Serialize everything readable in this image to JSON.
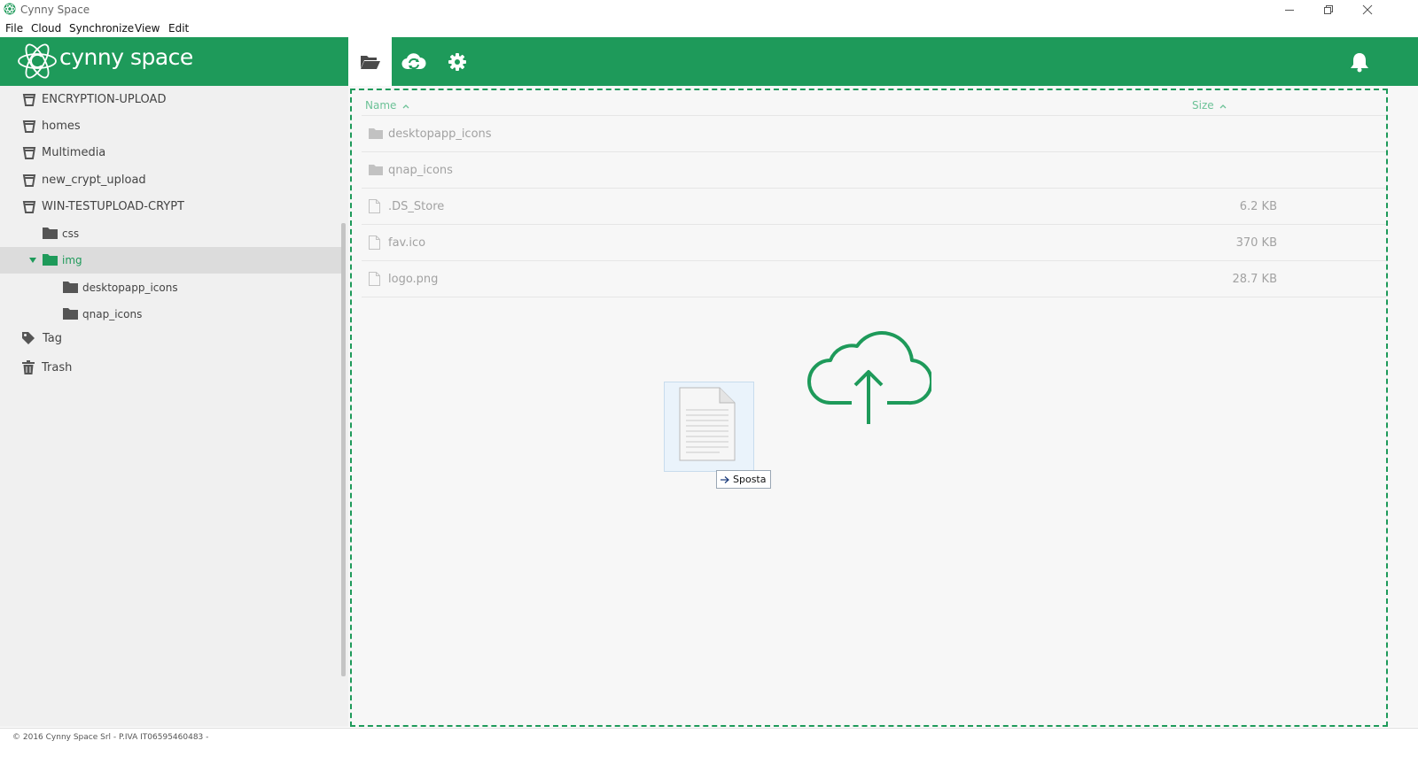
{
  "window": {
    "title": "Cynny Space",
    "controls": [
      "minimize-icon",
      "restore-icon",
      "close-icon"
    ]
  },
  "menu": {
    "items": [
      "File",
      "Cloud",
      "Synchronize",
      "View",
      "Edit"
    ]
  },
  "brand": {
    "logo_text": "cynny space",
    "accent": "#1e9a5a"
  },
  "toolbar": {
    "tabs": [
      {
        "icon": "folder-open-icon",
        "active": true
      },
      {
        "icon": "cloud-sync-icon",
        "active": false
      },
      {
        "icon": "gear-icon",
        "active": false
      }
    ],
    "notifications_icon": "bell-icon"
  },
  "sidebar": {
    "items": [
      {
        "label": "ENCRYPTION-UPLOAD",
        "icon": "storage-bucket-icon"
      },
      {
        "label": "homes",
        "icon": "storage-bucket-icon"
      },
      {
        "label": "Multimedia",
        "icon": "storage-bucket-icon"
      },
      {
        "label": "new_crypt_upload",
        "icon": "storage-bucket-icon"
      },
      {
        "label": "WIN-TESTUPLOAD-CRYPT",
        "icon": "storage-bucket-icon"
      },
      {
        "label": "css",
        "icon": "folder-icon"
      },
      {
        "label": "img",
        "icon": "folder-icon",
        "selected": true,
        "expanded": true
      },
      {
        "label": "desktopapp_icons",
        "icon": "folder-icon"
      },
      {
        "label": "qnap_icons",
        "icon": "folder-icon"
      },
      {
        "label": "Tag",
        "icon": "tag-icon"
      },
      {
        "label": "Trash",
        "icon": "trash-icon"
      }
    ]
  },
  "files": {
    "columns": {
      "name": "Name",
      "size": "Size"
    },
    "rows": [
      {
        "name": "desktopapp_icons",
        "size": "",
        "type": "folder"
      },
      {
        "name": "qnap_icons",
        "size": "",
        "type": "folder"
      },
      {
        "name": ".DS_Store",
        "size": "6.2 KB",
        "type": "file"
      },
      {
        "name": "fav.ico",
        "size": "370 KB",
        "type": "file"
      },
      {
        "name": "logo.png",
        "size": "28.7 KB",
        "type": "file"
      }
    ]
  },
  "dropzone": {
    "icon": "cloud-upload-icon",
    "drag_tooltip": "Sposta"
  },
  "footer": {
    "text": "© 2016 Cynny Space Srl - P.IVA IT06595460483 -"
  }
}
